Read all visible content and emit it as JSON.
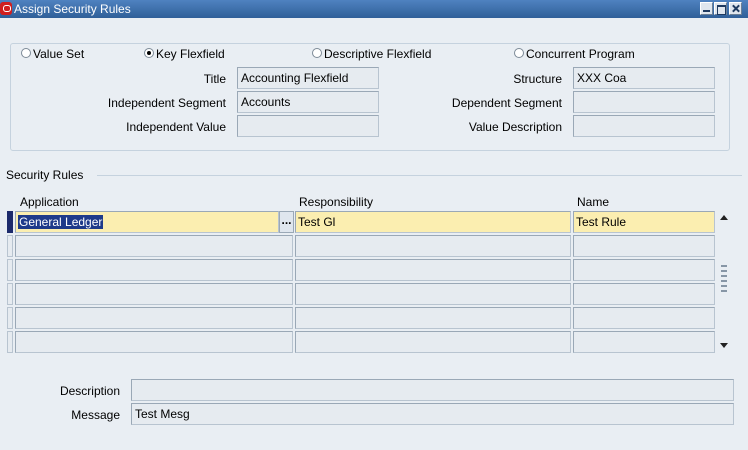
{
  "window": {
    "title": "Assign Security Rules",
    "icon": "oracle-app-icon"
  },
  "flexfield_type": {
    "options": [
      {
        "label": "Value Set",
        "checked": false
      },
      {
        "label": "Key Flexfield",
        "checked": true
      },
      {
        "label": "Descriptive Flexfield",
        "checked": false
      },
      {
        "label": "Concurrent Program",
        "checked": false
      }
    ]
  },
  "header": {
    "title_label": "Title",
    "title_value": "Accounting Flexfield",
    "structure_label": "Structure",
    "structure_value": "XXX Coa",
    "independent_segment_label": "Independent Segment",
    "independent_segment_value": "Accounts",
    "dependent_segment_label": "Dependent Segment",
    "dependent_segment_value": "",
    "independent_value_label": "Independent Value",
    "independent_value_value": "",
    "value_description_label": "Value Description",
    "value_description_value": ""
  },
  "security_rules": {
    "section_title": "Security Rules",
    "columns": {
      "application": "Application",
      "responsibility": "Responsibility",
      "name": "Name"
    },
    "lov_button": "...",
    "rows": [
      {
        "application": "General Ledger",
        "responsibility": "Test Gl",
        "name": "Test Rule"
      },
      {
        "application": "",
        "responsibility": "",
        "name": ""
      },
      {
        "application": "",
        "responsibility": "",
        "name": ""
      },
      {
        "application": "",
        "responsibility": "",
        "name": ""
      },
      {
        "application": "",
        "responsibility": "",
        "name": ""
      },
      {
        "application": "",
        "responsibility": "",
        "name": ""
      }
    ]
  },
  "footer": {
    "description_label": "Description",
    "description_value": "",
    "message_label": "Message",
    "message_value": "Test Mesg"
  },
  "colors": {
    "titlebar": "#3a6ea5",
    "background": "#e9eef3",
    "active_row": "#fbeeb0",
    "selection": "#1e3a8a"
  }
}
